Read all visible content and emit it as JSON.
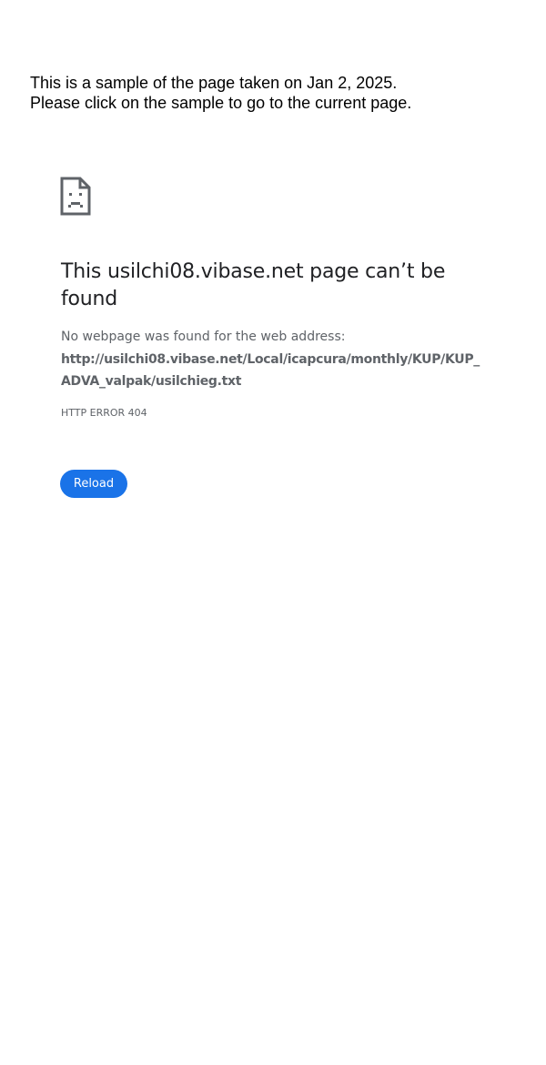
{
  "notice": {
    "line1": "This is a sample of the page taken on Jan 2, 2025.",
    "line2": "Please click on the sample to go to the current page."
  },
  "error_page": {
    "icon": "sad-document-icon",
    "title": "This usilchi08.vibase.net page can’t be found",
    "description": "No webpage was found for the web address:",
    "url": "http://usilchi08.vibase.net/Local/icapcura/monthly/KUP/KUP_ADVA_valpak/usilchieg.txt",
    "error_code": "HTTP ERROR 404",
    "reload_label": "Reload"
  },
  "colors": {
    "accent": "#1a73e8",
    "title": "#202124",
    "secondary_text": "#5f6368",
    "icon": "#5f6368"
  }
}
